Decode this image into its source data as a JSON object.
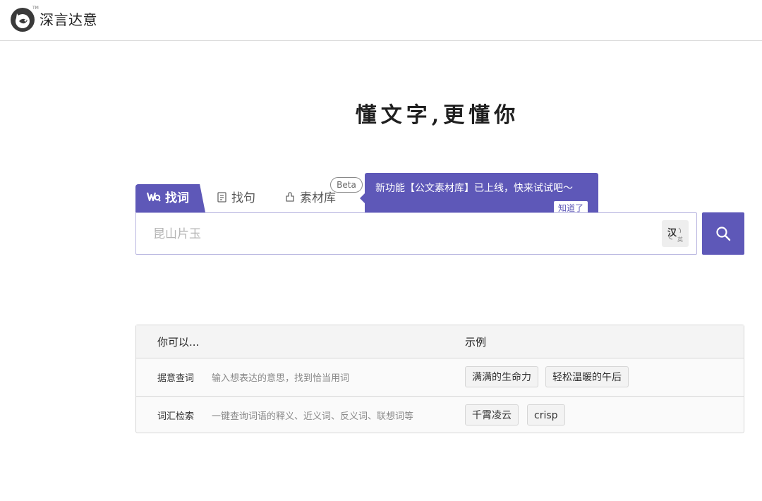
{
  "header": {
    "brand": "深言达意",
    "tm": "TM"
  },
  "slogan": "懂文字,更懂你",
  "tabs": [
    {
      "label": "找词",
      "icon": "wq-icon",
      "active": true
    },
    {
      "label": "找句",
      "icon": "sentence-icon",
      "active": false
    },
    {
      "label": "素材库",
      "icon": "puzzle-icon",
      "active": false
    }
  ],
  "beta_badge": "Beta",
  "tooltip": {
    "text": "新功能【公文素材库】已上线，快来试试吧～",
    "button": "知道了"
  },
  "search": {
    "placeholder": "昆山片玉",
    "lang_toggle": {
      "primary": "汉",
      "secondary": "英"
    }
  },
  "table": {
    "headers": [
      "你可以...",
      "示例"
    ],
    "rows": [
      {
        "label": "据意查词",
        "desc": "输入想表达的意思，找到恰当用词",
        "examples": [
          "满满的生命力",
          "轻松温暖的午后"
        ]
      },
      {
        "label": "词汇检索",
        "desc": "一键查询词语的释义、近义词、反义词、联想词等",
        "examples": [
          "千霄凌云",
          "crisp"
        ]
      }
    ]
  },
  "colors": {
    "accent": "#5e58b8"
  }
}
